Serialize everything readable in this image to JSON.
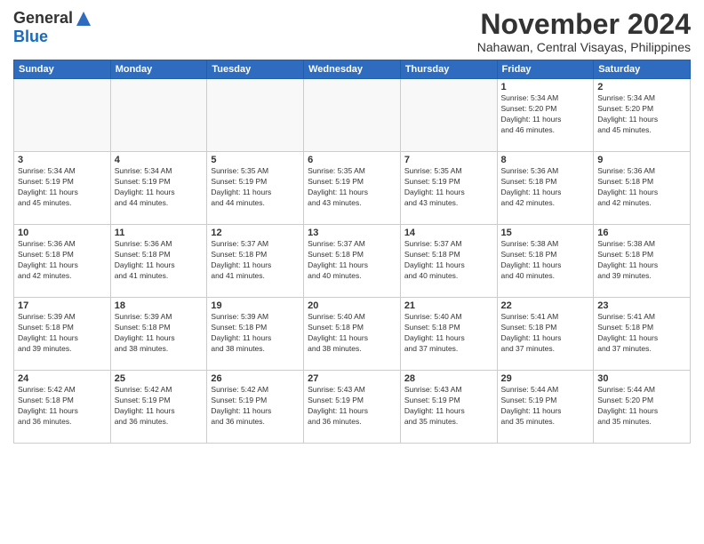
{
  "logo": {
    "general": "General",
    "blue": "Blue"
  },
  "title": {
    "month": "November 2024",
    "location": "Nahawan, Central Visayas, Philippines"
  },
  "headers": [
    "Sunday",
    "Monday",
    "Tuesday",
    "Wednesday",
    "Thursday",
    "Friday",
    "Saturday"
  ],
  "weeks": [
    [
      {
        "day": "",
        "info": ""
      },
      {
        "day": "",
        "info": ""
      },
      {
        "day": "",
        "info": ""
      },
      {
        "day": "",
        "info": ""
      },
      {
        "day": "",
        "info": ""
      },
      {
        "day": "1",
        "info": "Sunrise: 5:34 AM\nSunset: 5:20 PM\nDaylight: 11 hours\nand 46 minutes."
      },
      {
        "day": "2",
        "info": "Sunrise: 5:34 AM\nSunset: 5:20 PM\nDaylight: 11 hours\nand 45 minutes."
      }
    ],
    [
      {
        "day": "3",
        "info": "Sunrise: 5:34 AM\nSunset: 5:19 PM\nDaylight: 11 hours\nand 45 minutes."
      },
      {
        "day": "4",
        "info": "Sunrise: 5:34 AM\nSunset: 5:19 PM\nDaylight: 11 hours\nand 44 minutes."
      },
      {
        "day": "5",
        "info": "Sunrise: 5:35 AM\nSunset: 5:19 PM\nDaylight: 11 hours\nand 44 minutes."
      },
      {
        "day": "6",
        "info": "Sunrise: 5:35 AM\nSunset: 5:19 PM\nDaylight: 11 hours\nand 43 minutes."
      },
      {
        "day": "7",
        "info": "Sunrise: 5:35 AM\nSunset: 5:19 PM\nDaylight: 11 hours\nand 43 minutes."
      },
      {
        "day": "8",
        "info": "Sunrise: 5:36 AM\nSunset: 5:18 PM\nDaylight: 11 hours\nand 42 minutes."
      },
      {
        "day": "9",
        "info": "Sunrise: 5:36 AM\nSunset: 5:18 PM\nDaylight: 11 hours\nand 42 minutes."
      }
    ],
    [
      {
        "day": "10",
        "info": "Sunrise: 5:36 AM\nSunset: 5:18 PM\nDaylight: 11 hours\nand 42 minutes."
      },
      {
        "day": "11",
        "info": "Sunrise: 5:36 AM\nSunset: 5:18 PM\nDaylight: 11 hours\nand 41 minutes."
      },
      {
        "day": "12",
        "info": "Sunrise: 5:37 AM\nSunset: 5:18 PM\nDaylight: 11 hours\nand 41 minutes."
      },
      {
        "day": "13",
        "info": "Sunrise: 5:37 AM\nSunset: 5:18 PM\nDaylight: 11 hours\nand 40 minutes."
      },
      {
        "day": "14",
        "info": "Sunrise: 5:37 AM\nSunset: 5:18 PM\nDaylight: 11 hours\nand 40 minutes."
      },
      {
        "day": "15",
        "info": "Sunrise: 5:38 AM\nSunset: 5:18 PM\nDaylight: 11 hours\nand 40 minutes."
      },
      {
        "day": "16",
        "info": "Sunrise: 5:38 AM\nSunset: 5:18 PM\nDaylight: 11 hours\nand 39 minutes."
      }
    ],
    [
      {
        "day": "17",
        "info": "Sunrise: 5:39 AM\nSunset: 5:18 PM\nDaylight: 11 hours\nand 39 minutes."
      },
      {
        "day": "18",
        "info": "Sunrise: 5:39 AM\nSunset: 5:18 PM\nDaylight: 11 hours\nand 38 minutes."
      },
      {
        "day": "19",
        "info": "Sunrise: 5:39 AM\nSunset: 5:18 PM\nDaylight: 11 hours\nand 38 minutes."
      },
      {
        "day": "20",
        "info": "Sunrise: 5:40 AM\nSunset: 5:18 PM\nDaylight: 11 hours\nand 38 minutes."
      },
      {
        "day": "21",
        "info": "Sunrise: 5:40 AM\nSunset: 5:18 PM\nDaylight: 11 hours\nand 37 minutes."
      },
      {
        "day": "22",
        "info": "Sunrise: 5:41 AM\nSunset: 5:18 PM\nDaylight: 11 hours\nand 37 minutes."
      },
      {
        "day": "23",
        "info": "Sunrise: 5:41 AM\nSunset: 5:18 PM\nDaylight: 11 hours\nand 37 minutes."
      }
    ],
    [
      {
        "day": "24",
        "info": "Sunrise: 5:42 AM\nSunset: 5:18 PM\nDaylight: 11 hours\nand 36 minutes."
      },
      {
        "day": "25",
        "info": "Sunrise: 5:42 AM\nSunset: 5:19 PM\nDaylight: 11 hours\nand 36 minutes."
      },
      {
        "day": "26",
        "info": "Sunrise: 5:42 AM\nSunset: 5:19 PM\nDaylight: 11 hours\nand 36 minutes."
      },
      {
        "day": "27",
        "info": "Sunrise: 5:43 AM\nSunset: 5:19 PM\nDaylight: 11 hours\nand 36 minutes."
      },
      {
        "day": "28",
        "info": "Sunrise: 5:43 AM\nSunset: 5:19 PM\nDaylight: 11 hours\nand 35 minutes."
      },
      {
        "day": "29",
        "info": "Sunrise: 5:44 AM\nSunset: 5:19 PM\nDaylight: 11 hours\nand 35 minutes."
      },
      {
        "day": "30",
        "info": "Sunrise: 5:44 AM\nSunset: 5:20 PM\nDaylight: 11 hours\nand 35 minutes."
      }
    ]
  ]
}
